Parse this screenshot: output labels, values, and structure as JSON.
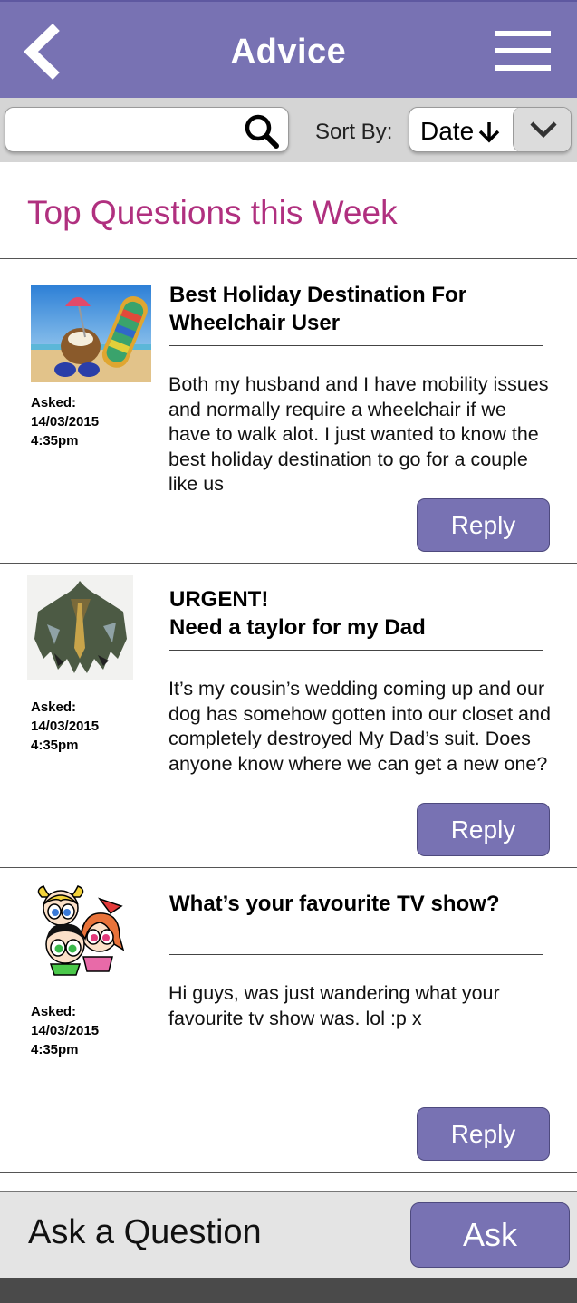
{
  "header": {
    "title": "Advice",
    "back_icon": "chevron-left-icon",
    "menu_icon": "hamburger-menu-icon",
    "color": "#7872b3"
  },
  "toolbar": {
    "search": {
      "value": "",
      "placeholder": "",
      "icon": "search-icon"
    },
    "sort_label": "Sort By:",
    "sort_value": "Date",
    "sort_direction_icon": "arrow-down-icon",
    "dropdown_icon": "chevron-down-icon"
  },
  "section_title": "Top Questions this Week",
  "section_title_color": "#b0307f",
  "questions": [
    {
      "thumbnail": "beach-coconut-flipflops-image",
      "asked_label": "Asked:",
      "asked_date": "14/03/2015",
      "asked_time": "4:35pm",
      "title_line1": "Best Holiday Destination For",
      "title_line2": "Wheelchair User",
      "body": "Both my husband and I have mobility issues and normally require a wheelchair if we have to walk alot. I just wanted to know the best holiday destination to go for a couple like us",
      "reply_label": "Reply"
    },
    {
      "thumbnail": "torn-shirt-image",
      "asked_label": "Asked:",
      "asked_date": "14/03/2015",
      "asked_time": "4:35pm",
      "title_line1": "URGENT!",
      "title_line2": "Need a taylor for my Dad",
      "body": "It’s my cousin’s wedding coming up and our dog has somehow gotten into our closet and completely destroyed My Dad’s suit. Does anyone know where we can get a new one?",
      "reply_label": "Reply"
    },
    {
      "thumbnail": "powerpuff-girls-image",
      "asked_label": "Asked:",
      "asked_date": "14/03/2015",
      "asked_time": "4:35pm",
      "title_line1": "What’s your favourite TV show?",
      "title_line2": "",
      "body": "Hi guys, was just wandering what your favourite tv show was. lol :p x",
      "reply_label": "Reply"
    }
  ],
  "ask_bar": {
    "label": "Ask a Question",
    "button_label": "Ask"
  }
}
